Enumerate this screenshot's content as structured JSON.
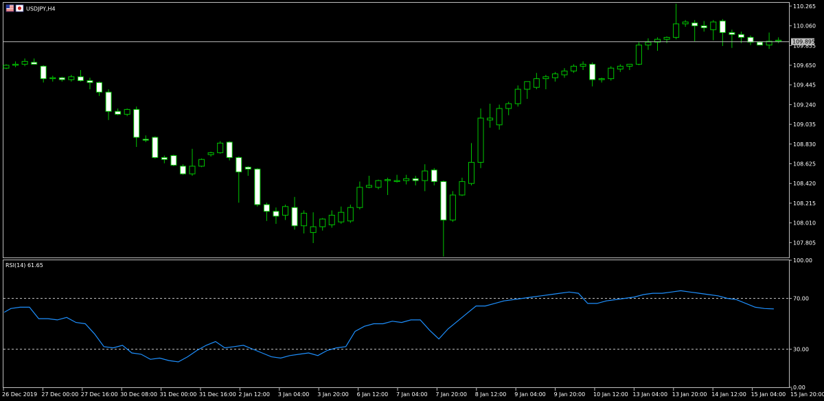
{
  "window": {
    "symbol_label": "USDJPY,H4",
    "flag_icons": [
      "us-flag-icon",
      "jp-flag-icon"
    ]
  },
  "rsi": {
    "label": "RSI(14) 61.65",
    "levels": [
      70,
      30
    ],
    "ylim": [
      0,
      100
    ],
    "ticks": [
      "100.00",
      "70.00",
      "30.00",
      "0.00"
    ]
  },
  "price_axis": {
    "ticks": [
      "110.265",
      "110.060",
      "109.855",
      "109.650",
      "109.445",
      "109.240",
      "109.035",
      "108.830",
      "108.625",
      "108.420",
      "108.215",
      "108.010",
      "107.805"
    ],
    "current_price": "109.895",
    "current_value": 109.895
  },
  "time_axis": {
    "labels": [
      "26 Dec 2019",
      "27 Dec 00:00",
      "27 Dec 16:00",
      "30 Dec 08:00",
      "31 Dec 00:00",
      "31 Dec 16:00",
      "2 Jan 12:00",
      "3 Jan 04:00",
      "3 Jan 20:00",
      "6 Jan 12:00",
      "7 Jan 04:00",
      "7 Jan 20:00",
      "8 Jan 12:00",
      "9 Jan 04:00",
      "9 Jan 20:00",
      "10 Jan 12:00",
      "13 Jan 04:00",
      "13 Jan 20:00",
      "14 Jan 12:00",
      "15 Jan 04:00",
      "15 Jan 20:00"
    ]
  },
  "colors": {
    "background": "#000000",
    "bull_outline": "#00c800",
    "bear_fill": "#ffffff",
    "rsi_line": "#1e90ff",
    "grid_frame": "#c0c0c0",
    "text": "#ffffff"
  },
  "chart_data": {
    "type": "candlestick",
    "ylim": [
      107.65,
      110.3
    ],
    "candles": [
      {
        "o": 109.62,
        "h": 109.66,
        "l": 109.61,
        "c": 109.65
      },
      {
        "o": 109.65,
        "h": 109.69,
        "l": 109.63,
        "c": 109.66
      },
      {
        "o": 109.66,
        "h": 109.72,
        "l": 109.64,
        "c": 109.69
      },
      {
        "o": 109.68,
        "h": 109.72,
        "l": 109.66,
        "c": 109.66
      },
      {
        "o": 109.64,
        "h": 109.65,
        "l": 109.47,
        "c": 109.51
      },
      {
        "o": 109.51,
        "h": 109.54,
        "l": 109.48,
        "c": 109.52
      },
      {
        "o": 109.52,
        "h": 109.53,
        "l": 109.48,
        "c": 109.5
      },
      {
        "o": 109.5,
        "h": 109.55,
        "l": 109.48,
        "c": 109.53
      },
      {
        "o": 109.53,
        "h": 109.6,
        "l": 109.48,
        "c": 109.49
      },
      {
        "o": 109.49,
        "h": 109.52,
        "l": 109.4,
        "c": 109.47
      },
      {
        "o": 109.47,
        "h": 109.48,
        "l": 109.33,
        "c": 109.37
      },
      {
        "o": 109.37,
        "h": 109.4,
        "l": 109.08,
        "c": 109.17
      },
      {
        "o": 109.17,
        "h": 109.2,
        "l": 109.13,
        "c": 109.14
      },
      {
        "o": 109.14,
        "h": 109.2,
        "l": 109.12,
        "c": 109.19
      },
      {
        "o": 109.19,
        "h": 109.22,
        "l": 108.8,
        "c": 108.9
      },
      {
        "o": 108.88,
        "h": 108.92,
        "l": 108.85,
        "c": 108.87
      },
      {
        "o": 108.9,
        "h": 108.91,
        "l": 108.68,
        "c": 108.69
      },
      {
        "o": 108.69,
        "h": 108.71,
        "l": 108.63,
        "c": 108.67
      },
      {
        "o": 108.71,
        "h": 108.72,
        "l": 108.6,
        "c": 108.61
      },
      {
        "o": 108.6,
        "h": 108.62,
        "l": 108.51,
        "c": 108.52
      },
      {
        "o": 108.52,
        "h": 108.78,
        "l": 108.5,
        "c": 108.6
      },
      {
        "o": 108.6,
        "h": 108.68,
        "l": 108.59,
        "c": 108.67
      },
      {
        "o": 108.72,
        "h": 108.75,
        "l": 108.7,
        "c": 108.74
      },
      {
        "o": 108.74,
        "h": 108.86,
        "l": 108.73,
        "c": 108.84
      },
      {
        "o": 108.85,
        "h": 108.86,
        "l": 108.66,
        "c": 108.69
      },
      {
        "o": 108.69,
        "h": 108.7,
        "l": 108.22,
        "c": 108.54
      },
      {
        "o": 108.59,
        "h": 108.6,
        "l": 108.5,
        "c": 108.57
      },
      {
        "o": 108.57,
        "h": 108.58,
        "l": 108.18,
        "c": 108.2
      },
      {
        "o": 108.2,
        "h": 108.22,
        "l": 108.03,
        "c": 108.13
      },
      {
        "o": 108.13,
        "h": 108.17,
        "l": 108.0,
        "c": 108.08
      },
      {
        "o": 108.09,
        "h": 108.2,
        "l": 108.04,
        "c": 108.18
      },
      {
        "o": 108.17,
        "h": 108.28,
        "l": 107.94,
        "c": 107.98
      },
      {
        "o": 107.98,
        "h": 108.14,
        "l": 107.9,
        "c": 108.11
      },
      {
        "o": 107.91,
        "h": 108.12,
        "l": 107.8,
        "c": 107.97
      },
      {
        "o": 107.97,
        "h": 108.06,
        "l": 107.93,
        "c": 108.05
      },
      {
        "o": 107.99,
        "h": 108.14,
        "l": 107.96,
        "c": 108.09
      },
      {
        "o": 108.02,
        "h": 108.18,
        "l": 108.0,
        "c": 108.12
      },
      {
        "o": 108.03,
        "h": 108.2,
        "l": 108.01,
        "c": 108.17
      },
      {
        "o": 108.17,
        "h": 108.44,
        "l": 108.15,
        "c": 108.38
      },
      {
        "o": 108.38,
        "h": 108.5,
        "l": 108.37,
        "c": 108.4
      },
      {
        "o": 108.38,
        "h": 108.46,
        "l": 108.36,
        "c": 108.45
      },
      {
        "o": 108.45,
        "h": 108.48,
        "l": 108.3,
        "c": 108.46
      },
      {
        "o": 108.44,
        "h": 108.51,
        "l": 108.43,
        "c": 108.45
      },
      {
        "o": 108.45,
        "h": 108.51,
        "l": 108.41,
        "c": 108.47
      },
      {
        "o": 108.47,
        "h": 108.5,
        "l": 108.4,
        "c": 108.45
      },
      {
        "o": 108.45,
        "h": 108.62,
        "l": 108.34,
        "c": 108.55
      },
      {
        "o": 108.56,
        "h": 108.58,
        "l": 108.4,
        "c": 108.44
      },
      {
        "o": 108.44,
        "h": 108.45,
        "l": 107.66,
        "c": 108.04
      },
      {
        "o": 108.04,
        "h": 108.34,
        "l": 108.02,
        "c": 108.3
      },
      {
        "o": 108.3,
        "h": 108.48,
        "l": 108.29,
        "c": 108.44
      },
      {
        "o": 108.42,
        "h": 108.84,
        "l": 108.4,
        "c": 108.64
      },
      {
        "o": 108.64,
        "h": 109.2,
        "l": 108.58,
        "c": 109.1
      },
      {
        "o": 109.08,
        "h": 109.25,
        "l": 109.0,
        "c": 109.1
      },
      {
        "o": 109.03,
        "h": 109.24,
        "l": 108.98,
        "c": 109.2
      },
      {
        "o": 109.2,
        "h": 109.27,
        "l": 109.13,
        "c": 109.25
      },
      {
        "o": 109.25,
        "h": 109.44,
        "l": 109.22,
        "c": 109.4
      },
      {
        "o": 109.4,
        "h": 109.48,
        "l": 109.3,
        "c": 109.48
      },
      {
        "o": 109.42,
        "h": 109.57,
        "l": 109.4,
        "c": 109.51
      },
      {
        "o": 109.51,
        "h": 109.55,
        "l": 109.4,
        "c": 109.53
      },
      {
        "o": 109.52,
        "h": 109.58,
        "l": 109.48,
        "c": 109.56
      },
      {
        "o": 109.55,
        "h": 109.62,
        "l": 109.52,
        "c": 109.59
      },
      {
        "o": 109.59,
        "h": 109.66,
        "l": 109.57,
        "c": 109.64
      },
      {
        "o": 109.64,
        "h": 109.69,
        "l": 109.6,
        "c": 109.66
      },
      {
        "o": 109.66,
        "h": 109.68,
        "l": 109.43,
        "c": 109.5
      },
      {
        "o": 109.5,
        "h": 109.52,
        "l": 109.47,
        "c": 109.51
      },
      {
        "o": 109.51,
        "h": 109.64,
        "l": 109.49,
        "c": 109.62
      },
      {
        "o": 109.61,
        "h": 109.66,
        "l": 109.58,
        "c": 109.64
      },
      {
        "o": 109.64,
        "h": 109.66,
        "l": 109.6,
        "c": 109.66
      },
      {
        "o": 109.66,
        "h": 109.89,
        "l": 109.65,
        "c": 109.86
      },
      {
        "o": 109.86,
        "h": 109.93,
        "l": 109.81,
        "c": 109.89
      },
      {
        "o": 109.89,
        "h": 109.94,
        "l": 109.8,
        "c": 109.92
      },
      {
        "o": 109.92,
        "h": 109.95,
        "l": 109.88,
        "c": 109.94
      },
      {
        "o": 109.94,
        "h": 110.29,
        "l": 109.92,
        "c": 110.08
      },
      {
        "o": 110.08,
        "h": 110.12,
        "l": 110.05,
        "c": 110.1
      },
      {
        "o": 110.09,
        "h": 110.12,
        "l": 109.9,
        "c": 110.06
      },
      {
        "o": 110.06,
        "h": 110.11,
        "l": 110.0,
        "c": 110.04
      },
      {
        "o": 110.02,
        "h": 110.12,
        "l": 109.91,
        "c": 110.1
      },
      {
        "o": 110.11,
        "h": 110.13,
        "l": 109.85,
        "c": 109.99
      },
      {
        "o": 109.99,
        "h": 110.02,
        "l": 109.83,
        "c": 109.97
      },
      {
        "o": 109.97,
        "h": 110.0,
        "l": 109.88,
        "c": 109.94
      },
      {
        "o": 109.94,
        "h": 109.96,
        "l": 109.86,
        "c": 109.89
      },
      {
        "o": 109.89,
        "h": 109.9,
        "l": 109.86,
        "c": 109.86
      },
      {
        "o": 109.86,
        "h": 109.99,
        "l": 109.82,
        "c": 109.9
      },
      {
        "o": 109.9,
        "h": 109.94,
        "l": 109.88,
        "c": 109.91
      }
    ],
    "rsi_values": [
      59,
      62,
      63,
      63,
      54,
      54,
      53,
      55,
      51,
      50,
      42,
      32,
      31,
      33,
      27,
      26,
      22,
      23,
      21,
      20,
      24,
      29,
      33,
      36,
      31,
      32,
      33,
      30,
      27,
      24,
      23,
      25,
      26,
      27,
      25,
      29,
      31,
      32,
      44,
      48,
      50,
      50,
      52,
      51,
      53,
      53,
      45,
      38,
      46,
      52,
      58,
      64,
      64,
      66,
      68,
      69,
      70,
      71,
      72,
      73,
      74,
      75,
      74,
      66,
      66,
      68,
      69,
      70,
      71,
      73,
      74,
      74,
      75,
      76,
      75,
      74,
      73,
      72,
      70,
      69,
      66,
      63,
      62,
      61.65
    ]
  }
}
